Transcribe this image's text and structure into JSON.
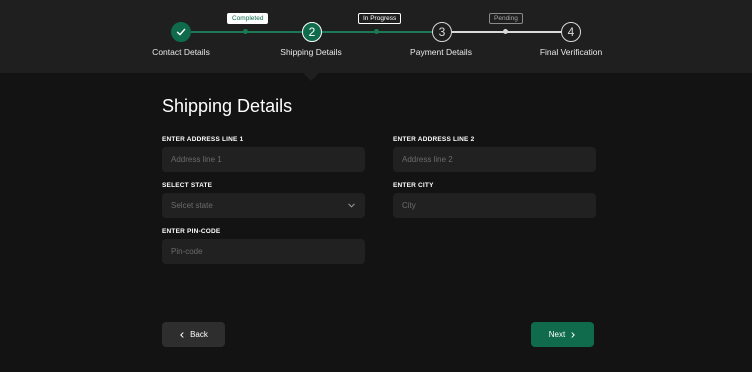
{
  "stepper": {
    "steps": [
      {
        "number": "1",
        "label": "Contact Details",
        "status": "completed"
      },
      {
        "number": "2",
        "label": "Shipping Details",
        "status": "current"
      },
      {
        "number": "3",
        "label": "Payment Details",
        "status": "todo"
      },
      {
        "number": "4",
        "label": "Final Verification",
        "status": "todo"
      }
    ],
    "badges": {
      "completed": "Completed",
      "in_progress": "In Progress",
      "pending": "Pending"
    }
  },
  "form": {
    "title": "Shipping Details",
    "address1": {
      "label": "ENTER ADDRESS LINE 1",
      "placeholder": "Address line 1",
      "value": ""
    },
    "address2": {
      "label": "ENTER ADDRESS LINE 2",
      "placeholder": "Address line 2",
      "value": ""
    },
    "state": {
      "label": "SELECT STATE",
      "placeholder": "Selcet state"
    },
    "city": {
      "label": "ENTER CITY",
      "placeholder": "City",
      "value": ""
    },
    "pincode": {
      "label": "ENTER PIN-CODE",
      "placeholder": "Pin-code",
      "value": ""
    }
  },
  "actions": {
    "back_label": "Back",
    "next_label": "Next"
  },
  "colors": {
    "accent": "#0f6b4b",
    "background": "#131313",
    "header": "#1f1f1f",
    "field": "#212121"
  },
  "icons": {
    "completed_step": "check-icon",
    "select": "chevron-down-icon",
    "back": "chevron-left-icon",
    "next": "chevron-right-icon"
  }
}
